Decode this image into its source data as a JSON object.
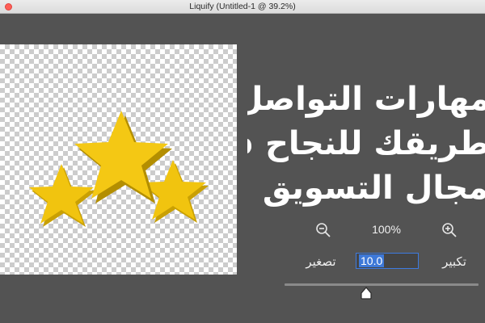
{
  "window": {
    "title": "Liquify (Untitled-1 @ 39.2%)"
  },
  "headline": {
    "line1": "مهارات التواصل،",
    "line2": "طريقك للنجاح في",
    "line3": "مجال التسويق"
  },
  "zoom": {
    "percent": "100%",
    "zoom_out_label": "تصغير",
    "zoom_in_label": "تكبير",
    "field_value": "10.0",
    "zoom_out_icon": "zoom-out-icon",
    "zoom_in_icon": "zoom-in-icon"
  },
  "colors": {
    "star": "#f1c40f",
    "star_shade": "#c9a003",
    "accent": "#3e79d8"
  }
}
